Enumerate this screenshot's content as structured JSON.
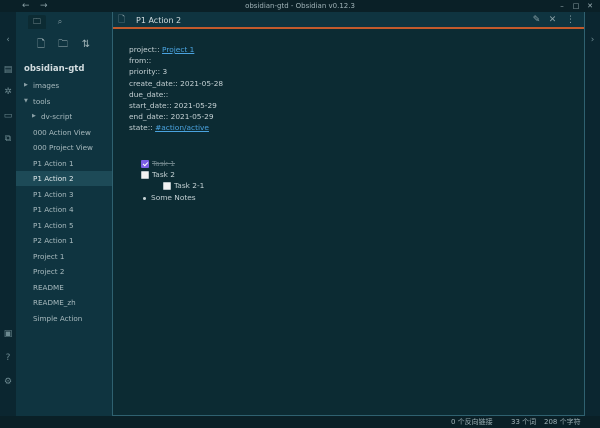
{
  "window": {
    "title": "obsidian-gtd - Obsidian v0.12.3",
    "back_glyph": "←",
    "forward_glyph": "→",
    "minimize_glyph": "–",
    "maximize_glyph": "□",
    "close_glyph": "✕"
  },
  "ribbon": {
    "collapse_glyph": "‹",
    "icons": [
      {
        "name": "open-quick-switcher-icon",
        "glyph": "▤"
      },
      {
        "name": "graph-view-icon",
        "glyph": "✲"
      },
      {
        "name": "open-command-palette-icon",
        "glyph": "▭"
      },
      {
        "name": "plugin-icon",
        "glyph": "⧉"
      }
    ],
    "bottom_icons": [
      {
        "name": "vault-switch-icon",
        "glyph": "▣"
      },
      {
        "name": "help-icon",
        "glyph": "?"
      },
      {
        "name": "settings-icon",
        "glyph": "⚙"
      }
    ]
  },
  "explorer": {
    "tabs": [
      {
        "name": "file-explorer-tab",
        "glyph": "🗀"
      },
      {
        "name": "search-tab",
        "glyph": "⌕"
      }
    ],
    "actions": [
      {
        "name": "new-note-icon",
        "glyph": "🗋"
      },
      {
        "name": "new-folder-icon",
        "glyph": "🗀"
      },
      {
        "name": "sort-icon",
        "glyph": "⇅"
      }
    ],
    "vault_name": "obsidian-gtd",
    "items": [
      {
        "label": "images",
        "caret": "▶",
        "depth": 0,
        "active": false
      },
      {
        "label": "tools",
        "caret": "▼",
        "depth": 0,
        "active": false
      },
      {
        "label": "dv-script",
        "caret": "▶",
        "depth": 1,
        "active": false
      },
      {
        "label": "000 Action View",
        "caret": "",
        "depth": 1,
        "active": false
      },
      {
        "label": "000 Project View",
        "caret": "",
        "depth": 1,
        "active": false
      },
      {
        "label": "P1 Action 1",
        "caret": "",
        "depth": 1,
        "active": false
      },
      {
        "label": "P1 Action 2",
        "caret": "",
        "depth": 1,
        "active": true
      },
      {
        "label": "P1 Action 3",
        "caret": "",
        "depth": 1,
        "active": false
      },
      {
        "label": "P1 Action 4",
        "caret": "",
        "depth": 1,
        "active": false
      },
      {
        "label": "P1 Action 5",
        "caret": "",
        "depth": 1,
        "active": false
      },
      {
        "label": "P2 Action 1",
        "caret": "",
        "depth": 1,
        "active": false
      },
      {
        "label": "Project 1",
        "caret": "",
        "depth": 1,
        "active": false
      },
      {
        "label": "Project 2",
        "caret": "",
        "depth": 1,
        "active": false
      },
      {
        "label": "README",
        "caret": "",
        "depth": 1,
        "active": false
      },
      {
        "label": "README_zh",
        "caret": "",
        "depth": 1,
        "active": false
      },
      {
        "label": "Simple Action",
        "caret": "",
        "depth": 1,
        "active": false
      }
    ]
  },
  "tab": {
    "title": "P1 Action 2",
    "doc_glyph": "🗋",
    "edit_glyph": "✎",
    "close_glyph": "✕",
    "more_glyph": "⋮"
  },
  "note": {
    "frontmatter": [
      {
        "key": "project::",
        "value": "Project 1",
        "is_link": true
      },
      {
        "key": "from::",
        "value": "",
        "is_link": false
      },
      {
        "key": "priority::",
        "value": "3",
        "is_link": false
      },
      {
        "key": "create_date::",
        "value": "2021-05-28",
        "is_link": false
      },
      {
        "key": "due_date::",
        "value": "",
        "is_link": false
      },
      {
        "key": "start_date::",
        "value": "2021-05-29",
        "is_link": false
      },
      {
        "key": "end_date::",
        "value": "2021-05-29",
        "is_link": false
      },
      {
        "key": "state::",
        "value": "#action/active",
        "is_link": true
      }
    ],
    "tasks": [
      {
        "label": "Task 1",
        "checked": true,
        "indent": 0
      },
      {
        "label": "Task 2",
        "checked": false,
        "indent": 0
      },
      {
        "label": "Task 2-1",
        "checked": false,
        "indent": 1
      }
    ],
    "bullets": [
      "Some Notes"
    ]
  },
  "right_ribbon": {
    "expand_glyph": "›"
  },
  "status": {
    "backlinks": "0 个反向链接",
    "words": "33 个词",
    "chars": "208 个字符"
  }
}
